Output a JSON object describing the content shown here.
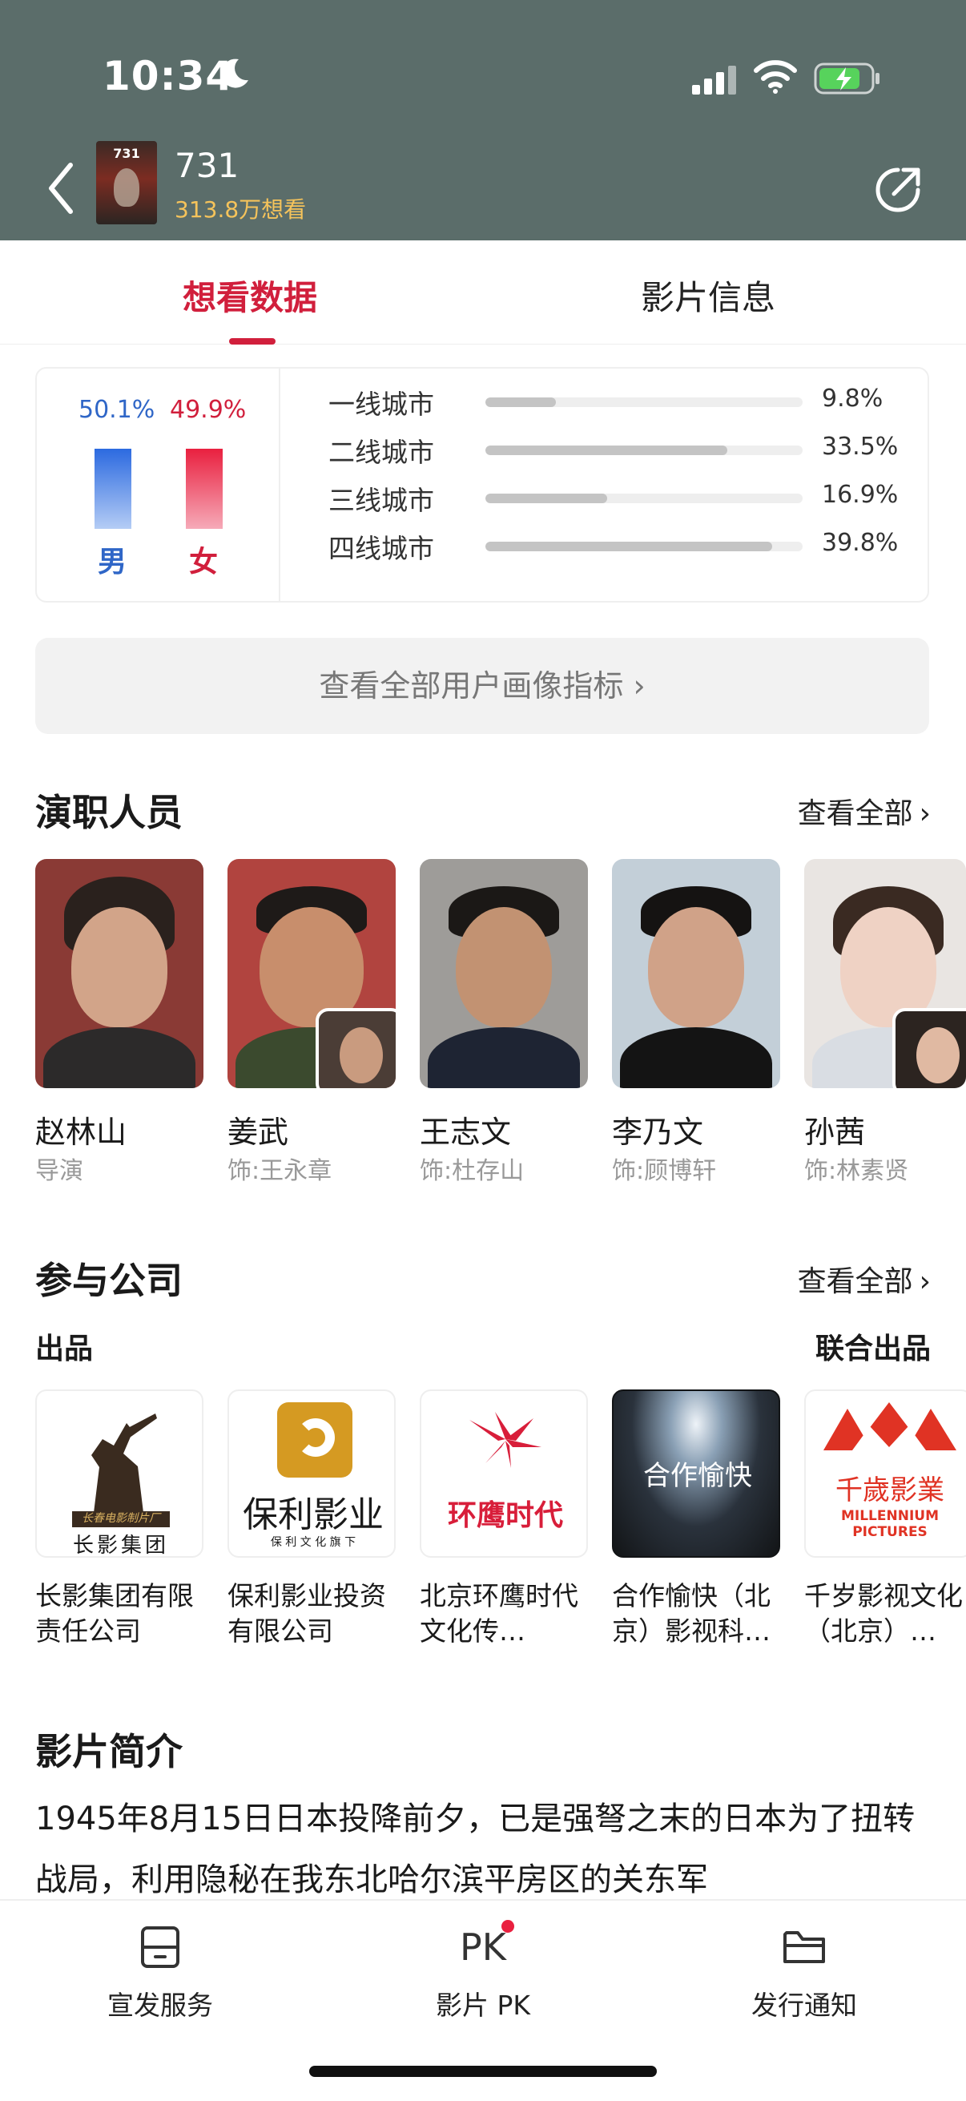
{
  "status_bar": {
    "time": "10:34"
  },
  "header": {
    "poster_text": "731",
    "title": "731",
    "want_count": "313.8万想看"
  },
  "tabs": [
    {
      "label": "想看数据",
      "active": true
    },
    {
      "label": "影片信息",
      "active": false
    }
  ],
  "gender": {
    "male_pct": "50.1%",
    "female_pct": "49.9%",
    "male_label": "男",
    "female_label": "女",
    "male_value": 50.1,
    "female_value": 49.9
  },
  "cities": [
    {
      "label": "一线城市",
      "pct": "9.8%",
      "value": 9.8
    },
    {
      "label": "二线城市",
      "pct": "33.5%",
      "value": 33.5
    },
    {
      "label": "三线城市",
      "pct": "16.9%",
      "value": 16.9
    },
    {
      "label": "四线城市",
      "pct": "39.8%",
      "value": 39.8
    }
  ],
  "portrait_button": "查看全部用户画像指标 ›",
  "cast": {
    "title": "演职人员",
    "see_all": "查看全部",
    "people": [
      {
        "name": "赵林山",
        "role": "导演"
      },
      {
        "name": "姜武",
        "role": "饰:王永章"
      },
      {
        "name": "王志文",
        "role": "饰:杜存山"
      },
      {
        "name": "李乃文",
        "role": "饰:顾博轩"
      },
      {
        "name": "孙茜",
        "role": "饰:林素贤"
      }
    ]
  },
  "companies": {
    "title": "参与公司",
    "see_all": "查看全部",
    "produced_label": "出品",
    "coproduced_label": "联合出品",
    "items": [
      {
        "name": "长影集团有限责任公司",
        "logo_text": "长影集团",
        "logo_sub": "长春电影制片厂"
      },
      {
        "name": "保利影业投资有限公司",
        "logo_text": "保利影业",
        "logo_sub": "保 利 文 化 旗 下"
      },
      {
        "name": "北京环鹰时代文化传…",
        "logo_text": "环鹰时代"
      },
      {
        "name": "合作愉快（北京）影视科…",
        "logo_text": "合作愉快"
      },
      {
        "name": "千岁影视文化（北京）…",
        "logo_text": "千歲影業",
        "logo_sub": "MILLENNIUM PICTURES"
      }
    ]
  },
  "synopsis": {
    "title": "影片简介",
    "text": "1945年8月15日日本投降前夕，已是强弩之末的日本为了扭转战局，利用隐秘在我东北哈尔滨平房区的关东军"
  },
  "bottom_nav": [
    {
      "label": "宣发服务",
      "icon": "drawer-icon"
    },
    {
      "label": "影片 PK",
      "icon": "pk-icon",
      "glyph": "PK"
    },
    {
      "label": "发行通知",
      "icon": "folder-icon"
    }
  ],
  "colors": {
    "header_bg": "#5b6d6a",
    "accent_red": "#d11f3c",
    "male_blue": "#2f66c7",
    "want_gold": "#f5c35b"
  }
}
